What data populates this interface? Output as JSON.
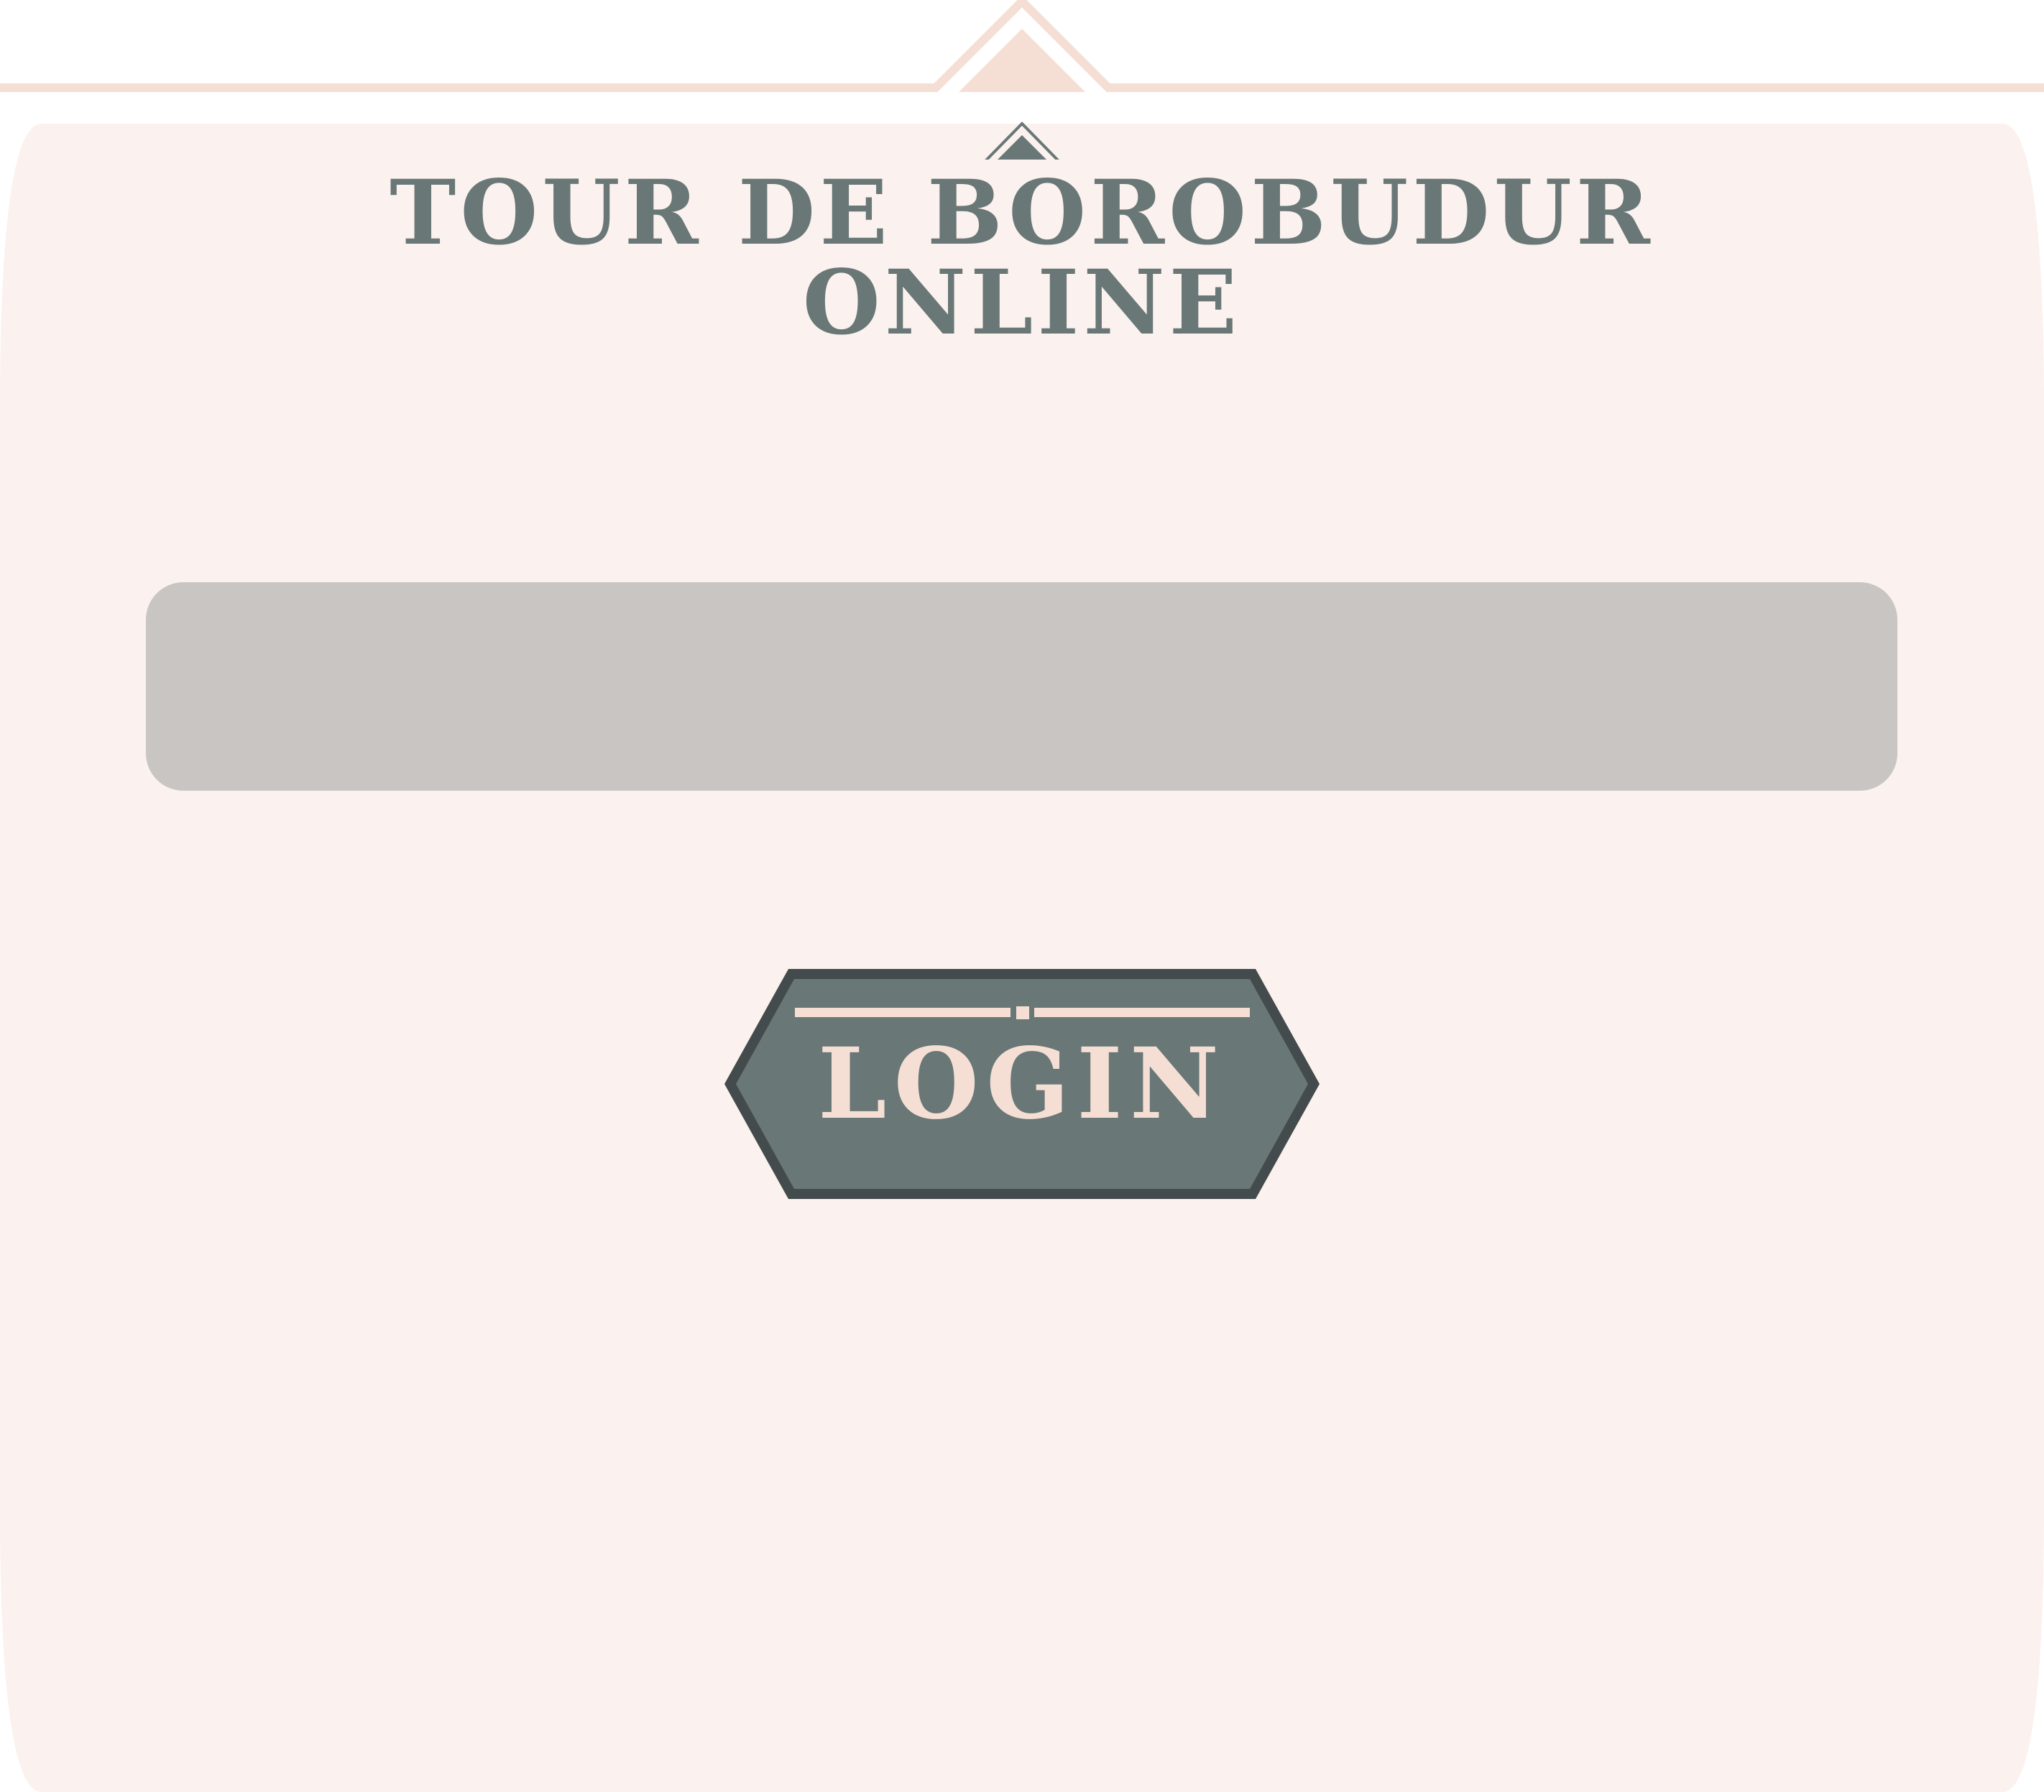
{
  "app": {
    "title_line_1": "TOUR DE BOROBUDUR",
    "title_line_2": "ONLINE"
  },
  "login_form": {
    "input_value": "",
    "input_placeholder": "",
    "button_label": "LOGIN"
  },
  "colors": {
    "page_background": "#ffffff",
    "panel_background": "#fbf1ee",
    "ornament": "#f5dfd4",
    "title_text": "#697777",
    "input_background": "#c8c5c2",
    "button_fill": "#697777",
    "button_border": "#434b4c",
    "button_text": "#f5dfd4"
  }
}
